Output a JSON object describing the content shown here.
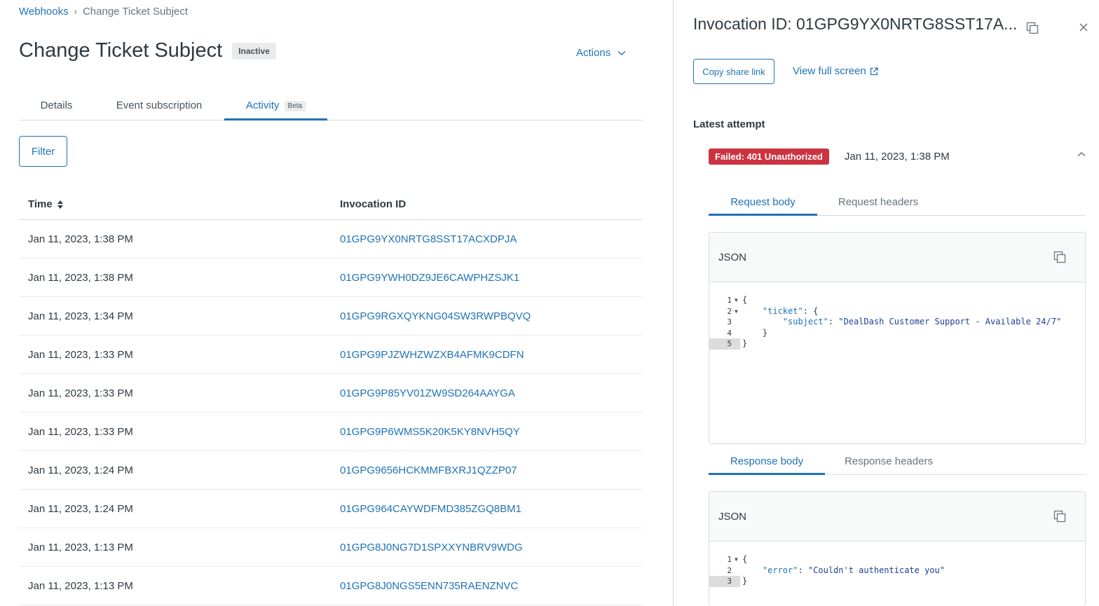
{
  "breadcrumb": {
    "parent": "Webhooks",
    "current": "Change Ticket Subject"
  },
  "page": {
    "title": "Change Ticket Subject",
    "status_badge": "Inactive",
    "actions_label": "Actions"
  },
  "tabs": [
    {
      "label": "Details"
    },
    {
      "label": "Event subscription"
    },
    {
      "label": "Activity",
      "tag": "Beta"
    }
  ],
  "filter_label": "Filter",
  "table": {
    "headers": {
      "time": "Time",
      "invocation_id": "Invocation ID"
    },
    "rows": [
      {
        "time": "Jan 11, 2023, 1:38 PM",
        "id": "01GPG9YX0NRTG8SST17ACXDPJA"
      },
      {
        "time": "Jan 11, 2023, 1:38 PM",
        "id": "01GPG9YWH0DZ9JE6CAWPHZSJK1"
      },
      {
        "time": "Jan 11, 2023, 1:34 PM",
        "id": "01GPG9RGXQYKNG04SW3RWPBQVQ"
      },
      {
        "time": "Jan 11, 2023, 1:33 PM",
        "id": "01GPG9PJZWHZWZXB4AFMK9CDFN"
      },
      {
        "time": "Jan 11, 2023, 1:33 PM",
        "id": "01GPG9P85YV01ZW9SD264AAYGA"
      },
      {
        "time": "Jan 11, 2023, 1:33 PM",
        "id": "01GPG9P6WMS5K20K5KY8NVH5QY"
      },
      {
        "time": "Jan 11, 2023, 1:24 PM",
        "id": "01GPG9656HCKMMFBXRJ1QZZP07"
      },
      {
        "time": "Jan 11, 2023, 1:24 PM",
        "id": "01GPG964CAYWDFMD385ZGQ8BM1"
      },
      {
        "time": "Jan 11, 2023, 1:13 PM",
        "id": "01GPG8J0NG7D1SPXXYNBRV9WDG"
      },
      {
        "time": "Jan 11, 2023, 1:13 PM",
        "id": "01GPG8J0NGS5ENN735RAENZNVC"
      }
    ]
  },
  "drawer": {
    "title": "Invocation ID: 01GPG9YX0NRTG8SST17A...",
    "copy_share_link": "Copy share link",
    "view_full_screen": "View full screen",
    "latest_attempt_label": "Latest attempt",
    "attempt_status": "Failed: 401 Unauthorized",
    "attempt_time": "Jan 11, 2023, 1:38 PM",
    "request_tabs": [
      "Request body",
      "Request headers"
    ],
    "response_tabs": [
      "Response body",
      "Response headers"
    ],
    "request_json": {
      "label": "JSON",
      "line_numbers": [
        "1",
        "2",
        "3",
        "4",
        "5"
      ],
      "ticket_key": "\"ticket\"",
      "subject_key": "\"subject\"",
      "subject_value": "\"DealDash Customer Support - Available 24/7\""
    },
    "response_json": {
      "label": "JSON",
      "line_numbers": [
        "1",
        "2",
        "3"
      ],
      "error_key": "\"error\"",
      "error_value": "\"Couldn't authenticate you\""
    }
  },
  "colors": {
    "accent": "#1f73b7",
    "danger": "#cc3340",
    "text": "#2f3941",
    "muted": "#68737d"
  }
}
